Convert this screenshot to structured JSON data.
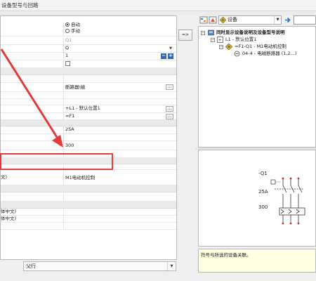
{
  "window": {
    "title": "设备型号与回路"
  },
  "properties": {
    "rows": [
      {
        "value_a": "自动",
        "value_b": "手动"
      },
      {
        "value": "Q1"
      },
      {
        "value": "Q"
      },
      {
        "value": "1"
      },
      {
        "checkbox": false
      },
      {
        "value": "断路器\\磁"
      },
      {
        "value": "+L1 - 默认位置1"
      },
      {
        "value": "=F1"
      },
      {
        "value": "25A"
      },
      {
        "value": "300"
      },
      {
        "label": "文)",
        "value": "M1电动机控制"
      },
      {
        "label": "体中文)"
      },
      {
        "label": "体中文)"
      }
    ],
    "radio_selected": "自动"
  },
  "transfer_button": {
    "label": "=>"
  },
  "bottom": {
    "combo_value": "父行"
  },
  "right_toolbar": {
    "filter_value": "设备"
  },
  "tree": {
    "items": [
      {
        "label": "同时显示设备说明及设备型号说明",
        "bold": true
      },
      {
        "label": "L1 - 默认位置1"
      },
      {
        "label": "=F1-Q1 - M1电动机控制"
      },
      {
        "label": "04-4 - 电磁断路器 (1,2...)"
      }
    ]
  },
  "preview": {
    "tag": "-Q1",
    "rating": "25A",
    "value": "300"
  },
  "info": {
    "text": "符号与所选的设备关联。"
  },
  "colors": {
    "highlight": "#e03a3a",
    "arrow": "#e03a3a",
    "accent": "#2d67b5"
  }
}
